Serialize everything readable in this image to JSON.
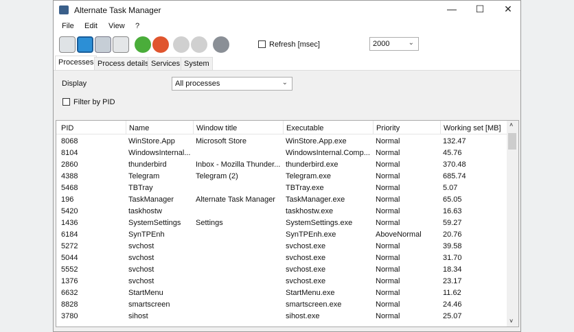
{
  "window": {
    "title": "Alternate Task Manager",
    "minimize": "—",
    "maximize": "☐",
    "close": "✕"
  },
  "menu": [
    "File",
    "Edit",
    "View",
    "?"
  ],
  "toolbar": {
    "icons": [
      "new-icon",
      "save-icon",
      "print-icon",
      "copy-icon",
      "refresh-icon",
      "kill-icon",
      "play-icon",
      "stop-icon",
      "settings-icon"
    ],
    "refresh_label": "Refresh [msec]",
    "refresh_checked": false,
    "interval": "2000"
  },
  "tabs": [
    "Processes",
    "Process details",
    "Services",
    "System"
  ],
  "filters": {
    "display_label": "Display",
    "display_value": "All processes",
    "filter_pid_label": "Filter by PID",
    "filter_pid_checked": false
  },
  "table": {
    "columns": [
      "PID",
      "Name",
      "Window title",
      "Executable",
      "Priority",
      "Working set [MB]"
    ],
    "rows": [
      [
        "8068",
        "WinStore.App",
        "Microsoft Store",
        "WinStore.App.exe",
        "Normal",
        "132.47"
      ],
      [
        "8104",
        "WindowsInternal...",
        "",
        "WindowsInternal.Comp...",
        "Normal",
        "45.76"
      ],
      [
        "2860",
        "thunderbird",
        "Inbox - Mozilla Thunder...",
        "thunderbird.exe",
        "Normal",
        "370.48"
      ],
      [
        "4388",
        "Telegram",
        "Telegram (2)",
        "Telegram.exe",
        "Normal",
        "685.74"
      ],
      [
        "5468",
        "TBTray",
        "",
        "TBTray.exe",
        "Normal",
        "5.07"
      ],
      [
        "196",
        "TaskManager",
        "Alternate Task Manager",
        "TaskManager.exe",
        "Normal",
        "65.05"
      ],
      [
        "5420",
        "taskhostw",
        "",
        "taskhostw.exe",
        "Normal",
        "16.63"
      ],
      [
        "1436",
        "SystemSettings",
        "Settings",
        "SystemSettings.exe",
        "Normal",
        "59.27"
      ],
      [
        "6184",
        "SynTPEnh",
        "",
        "SynTPEnh.exe",
        "AboveNormal",
        "20.76"
      ],
      [
        "5272",
        "svchost",
        "",
        "svchost.exe",
        "Normal",
        "39.58"
      ],
      [
        "5044",
        "svchost",
        "",
        "svchost.exe",
        "Normal",
        "31.70"
      ],
      [
        "5552",
        "svchost",
        "",
        "svchost.exe",
        "Normal",
        "18.34"
      ],
      [
        "1376",
        "svchost",
        "",
        "svchost.exe",
        "Normal",
        "23.17"
      ],
      [
        "6632",
        "StartMenu",
        "",
        "StartMenu.exe",
        "Normal",
        "11.62"
      ],
      [
        "8828",
        "smartscreen",
        "",
        "smartscreen.exe",
        "Normal",
        "24.46"
      ],
      [
        "3780",
        "sihost",
        "",
        "sihost.exe",
        "Normal",
        "25.07"
      ]
    ]
  }
}
